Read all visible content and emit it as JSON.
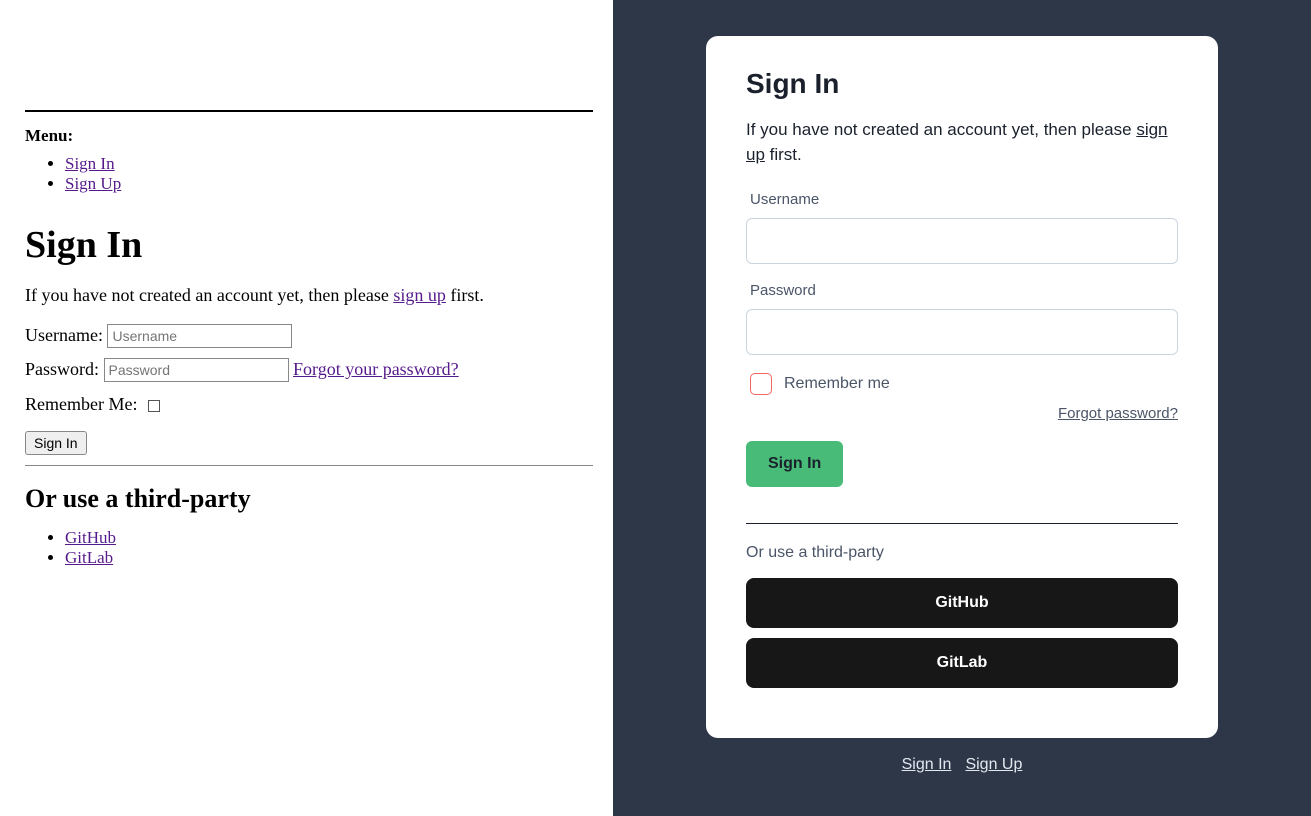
{
  "menu": {
    "label": "Menu:",
    "sign_in": "Sign In",
    "sign_up": "Sign Up"
  },
  "heading": "Sign In",
  "intro_prefix": "If you have not created an account yet, then please ",
  "intro_link": "sign up",
  "intro_suffix": " first.",
  "left": {
    "username_label": "Username: ",
    "username_placeholder": "Username",
    "password_label": "Password: ",
    "password_placeholder": "Password",
    "forgot_link": "Forgot your password?",
    "remember_label": "Remember Me: ",
    "submit": "Sign In",
    "third_party_heading": "Or use a third-party",
    "github": "GitHub",
    "gitlab": "GitLab"
  },
  "right": {
    "username_label": "Username",
    "password_label": "Password",
    "remember_label": "Remember me",
    "forgot_link": "Forgot password?",
    "submit": "Sign In",
    "third_party_label": "Or use a third-party",
    "github": "GitHub",
    "gitlab": "GitLab"
  },
  "bottom": {
    "sign_in": "Sign In",
    "sign_up": "Sign Up"
  }
}
